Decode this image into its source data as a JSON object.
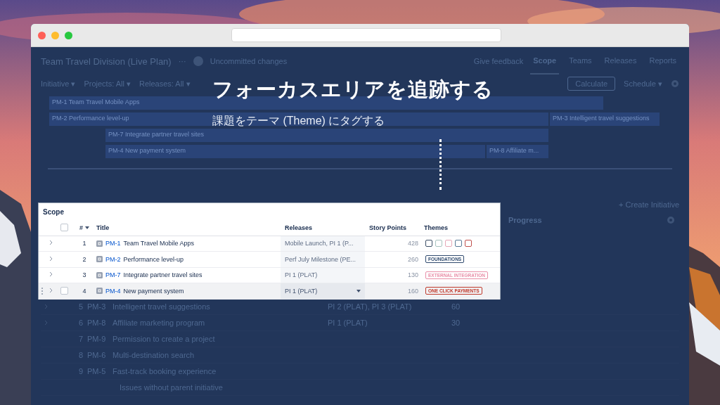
{
  "app": {
    "title": "Team Travel Division (Live Plan)",
    "more": "···",
    "status": "Uncommitted changes",
    "feedback": "Give feedback",
    "tabs": [
      {
        "label": "Scope",
        "selected": true
      },
      {
        "label": "Teams",
        "selected": false
      },
      {
        "label": "Releases",
        "selected": false
      },
      {
        "label": "Reports",
        "selected": false
      }
    ],
    "filters": [
      "Initiative ▾",
      "Projects: All ▾",
      "Releases: All ▾"
    ],
    "calculate": "Calculate",
    "schedule": "Schedule ▾",
    "roadmap": [
      {
        "bars": [
          "PM-1 Team Travel Mobile Apps"
        ]
      },
      {
        "bars": [
          "PM-2 Performance level-up",
          "PM-3 Intelligent travel suggestions"
        ]
      },
      {
        "bars": [
          "PM-7 Integrate partner travel sites"
        ]
      },
      {
        "bars": [
          "PM-4 New payment system",
          "PM-8 Affiliate m..."
        ]
      }
    ],
    "create": "+ Create Initiative",
    "progress": "Progress",
    "rows": [
      {
        "number": "5",
        "key": "PM-3",
        "title": "Intelligent travel suggestions",
        "release": "PI 2 (PLAT), PI 3 (PLAT)",
        "points": "60",
        "expandable": true
      },
      {
        "number": "6",
        "key": "PM-8",
        "title": "Affiliate marketing program",
        "release": "PI 1 (PLAT)",
        "points": "30",
        "expandable": true
      },
      {
        "number": "7",
        "key": "PM-9",
        "title": "Permission to create a project",
        "expandable": false
      },
      {
        "number": "8",
        "key": "PM-6",
        "title": "Multi-destination search",
        "expandable": false
      },
      {
        "number": "9",
        "key": "PM-5",
        "title": "Fast-track booking experience",
        "expandable": false
      }
    ],
    "footer": "Issues without parent initiative"
  },
  "callout": {
    "headline": "フォーカスエリアを追跡する",
    "subtitle": "課題をテーマ (Theme) にタグする"
  },
  "scope_panel": {
    "title": "Scope",
    "select_all_checked": false,
    "columns": [
      "#",
      "Title",
      "Releases",
      "Story Points",
      "Themes"
    ],
    "rows": [
      {
        "number": "1",
        "key": "PM-1",
        "title": "Team Travel Mobile Apps",
        "release": "Mobile Launch, PI 1 (P...",
        "points": "428",
        "hovered": false,
        "checked": false,
        "themes": [
          {
            "color": "#3d4f66"
          },
          {
            "color": "#a9c4c0"
          },
          {
            "color": "#e6a9b8"
          },
          {
            "color": "#5a7a96"
          },
          {
            "color": "#c0504d"
          }
        ]
      },
      {
        "number": "2",
        "key": "PM-2",
        "title": "Performance level-up",
        "release": "Perf July Milestone (PE...",
        "points": "260",
        "hovered": false,
        "checked": false,
        "themes": [
          {
            "label": "FOUNDATIONS",
            "color": "#2f4a6e"
          }
        ]
      },
      {
        "number": "3",
        "key": "PM-7",
        "title": "Integrate partner travel sites",
        "release": "PI 1 (PLAT)",
        "points": "130",
        "hovered": false,
        "checked": false,
        "themes": [
          {
            "label": "EXTERNAL INTEGRATION",
            "color": "#e88fa8"
          }
        ]
      },
      {
        "number": "4",
        "key": "PM-4",
        "title": "New payment system",
        "release": "PI 1 (PLAT)",
        "points": "160",
        "hovered": true,
        "checked": false,
        "themes": [
          {
            "label": "ONE CLICK PAYMENTS",
            "color": "#c0392b"
          }
        ]
      }
    ]
  }
}
